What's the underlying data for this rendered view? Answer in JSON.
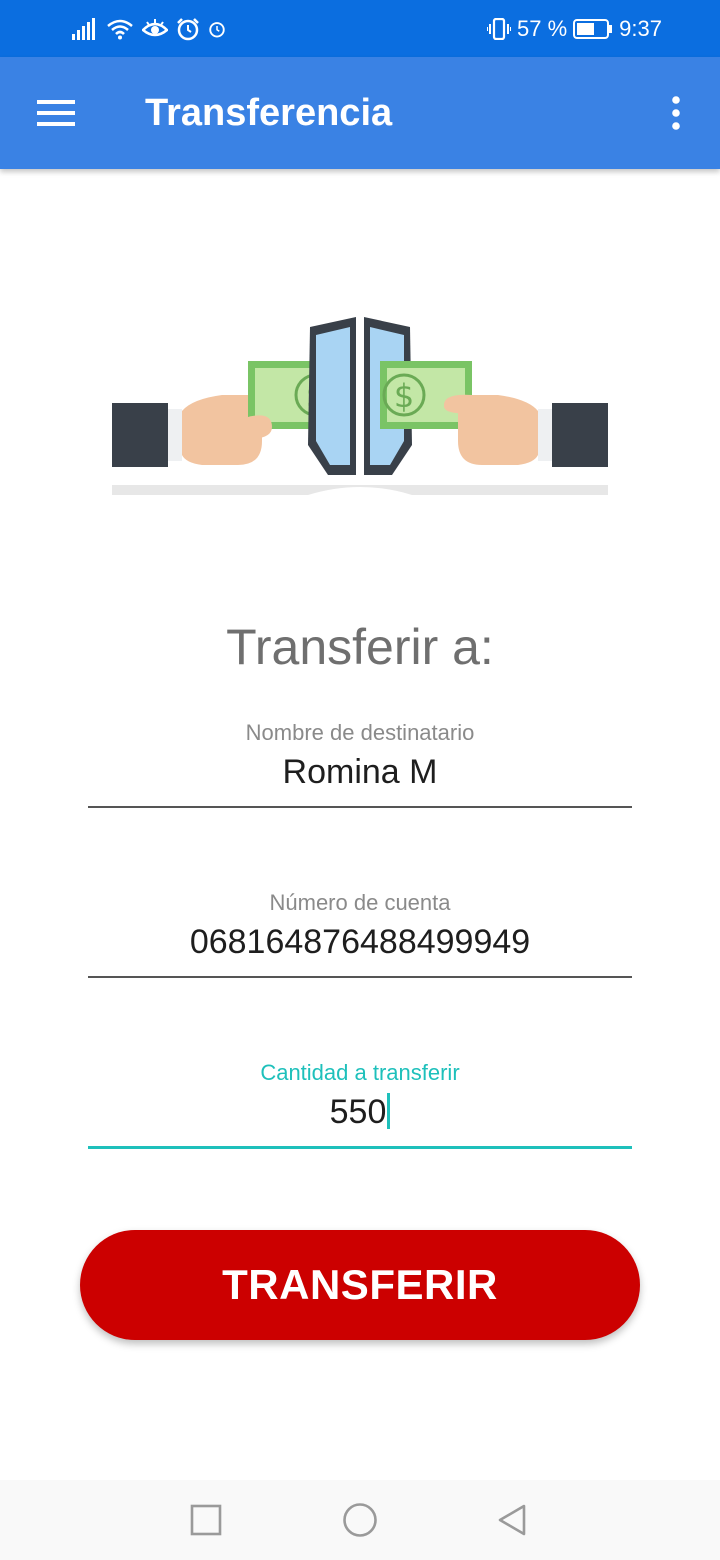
{
  "status_bar": {
    "battery_percent": "57 %",
    "time": "9:37",
    "icons": [
      "signal-icon",
      "wifi-icon",
      "eye-comfort-icon",
      "alarm-icon",
      "alarm-small-icon",
      "vibrate-icon",
      "battery-icon"
    ]
  },
  "app_bar": {
    "title": "Transferencia",
    "menu_icon": "hamburger-menu-icon",
    "overflow_icon": "more-vert-icon",
    "color": "#3a82e4"
  },
  "form": {
    "heading": "Transferir a:",
    "recipient": {
      "label": "Nombre de destinatario",
      "value": "Romina M"
    },
    "account": {
      "label": "Número de cuenta",
      "value": "068164876488499949"
    },
    "amount": {
      "label": "Cantidad a transferir",
      "value": "550"
    },
    "accent_color": "#1ec0bb"
  },
  "submit": {
    "label": "TRANSFERIR",
    "color": "#cc0000"
  },
  "nav_bar": {
    "icons": [
      "recents-square-icon",
      "home-circle-icon",
      "back-triangle-icon"
    ]
  }
}
